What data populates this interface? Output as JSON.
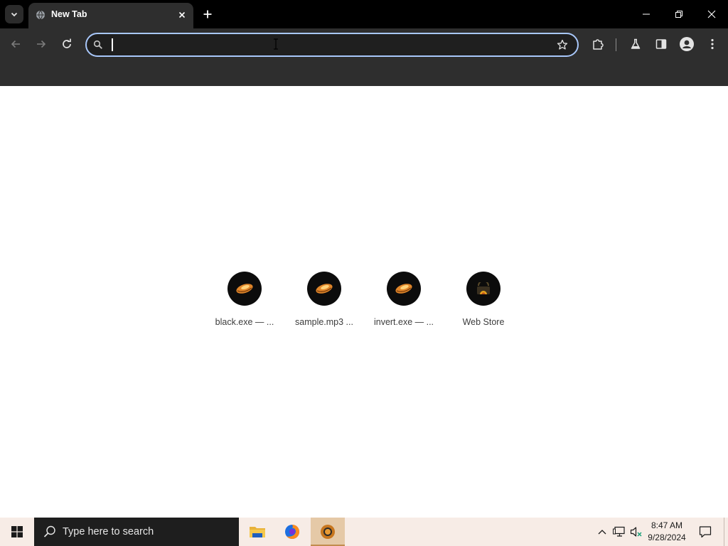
{
  "browser": {
    "tab": {
      "title": "New Tab"
    },
    "omnibox": {
      "value": "",
      "placeholder": ""
    }
  },
  "ntp": {
    "shortcuts": [
      {
        "label": "black.exe — ...",
        "icon": "ember-icon"
      },
      {
        "label": "sample.mp3 ...",
        "icon": "ember-icon"
      },
      {
        "label": "invert.exe — ...",
        "icon": "ember-icon"
      },
      {
        "label": "Web Store",
        "icon": "web-store-icon"
      }
    ]
  },
  "taskbar": {
    "search_placeholder": "Type here to search",
    "clock": {
      "time": "8:47 AM",
      "date": "9/28/2024"
    },
    "apps": [
      "file-explorer-icon",
      "firefox-icon",
      "chrome-icon"
    ]
  },
  "colors": {
    "titlebar": "#000000",
    "toolbar": "#2e2e2e",
    "omnibox_border": "#a8c7fa",
    "taskbar": "#f7ece6",
    "taskbar_active": "#e5c9a7"
  }
}
